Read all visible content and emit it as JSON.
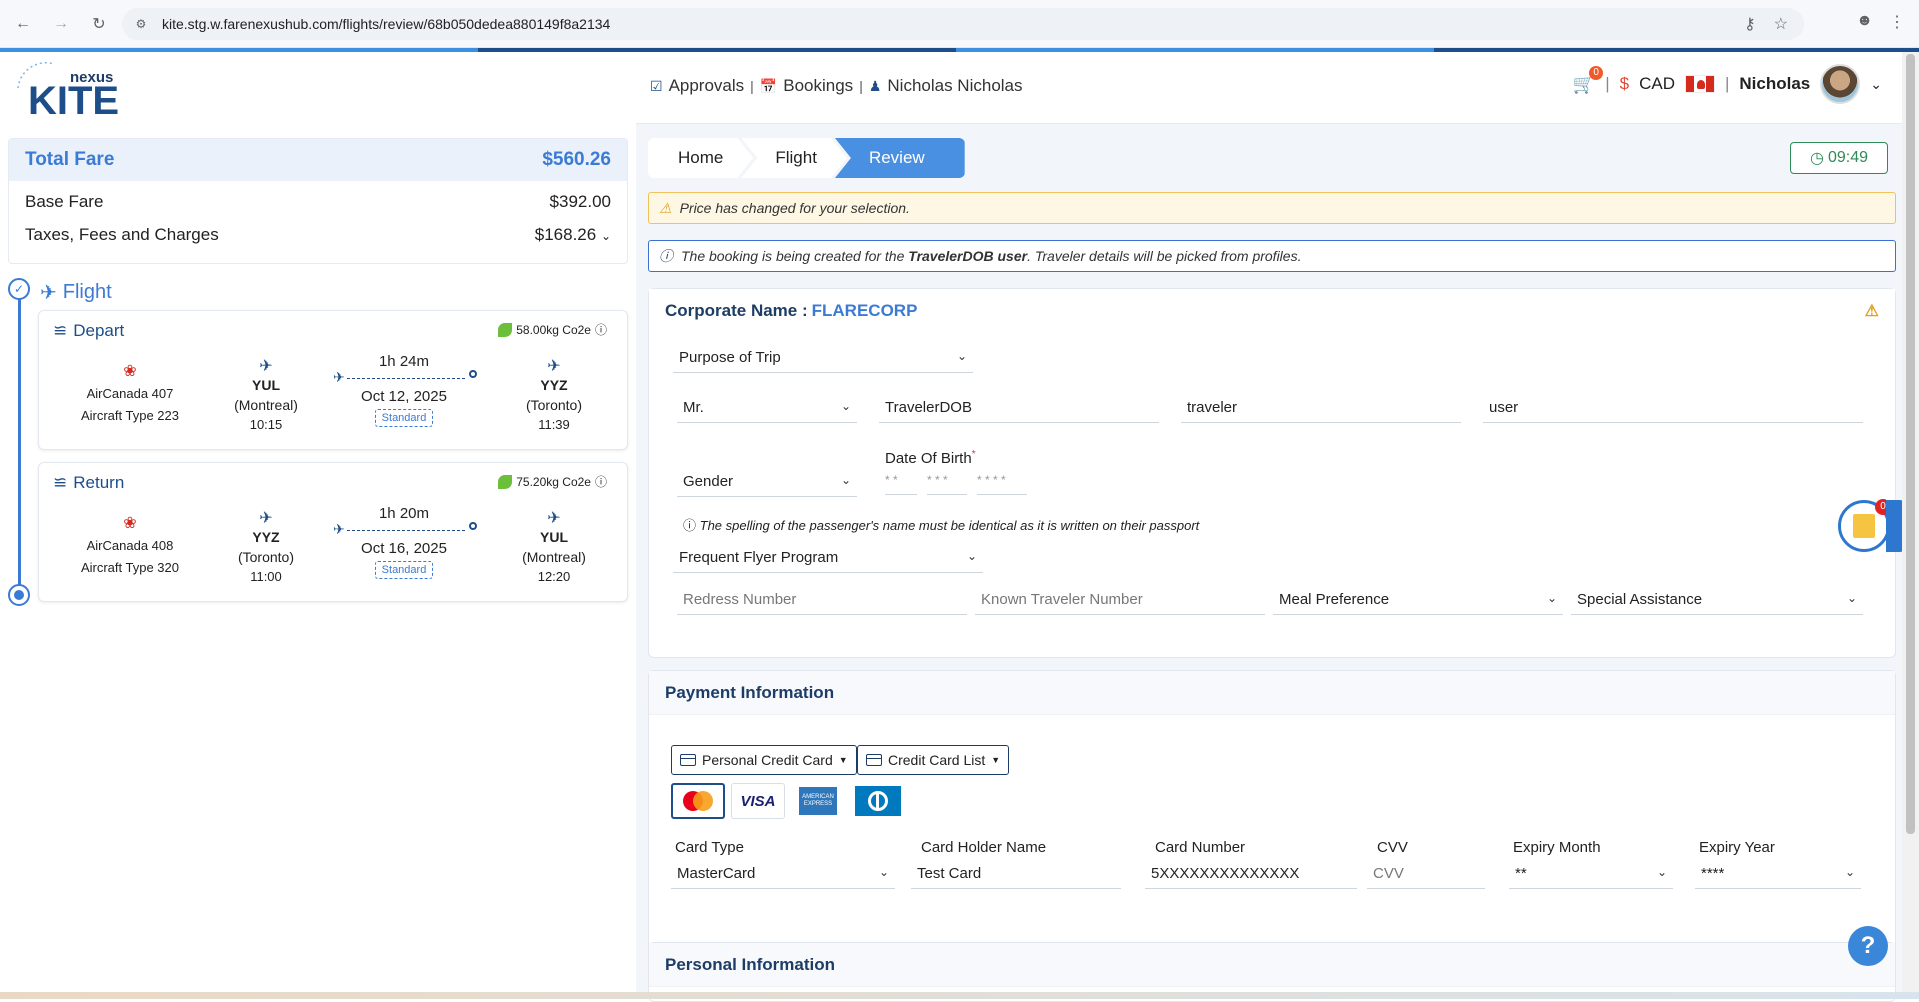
{
  "browser": {
    "url": "kite.stg.w.farenexushub.com/flights/review/68b050dedea880149f8a2134"
  },
  "logo": {
    "sub": "nexus",
    "main": "KITE"
  },
  "fare": {
    "total_label": "Total Fare",
    "total_value": "$560.26",
    "base_label": "Base Fare",
    "base_value": "$392.00",
    "taxes_label": "Taxes, Fees and Charges",
    "taxes_value": "$168.26"
  },
  "flight_section": {
    "title": "Flight"
  },
  "depart": {
    "label": "Depart",
    "co2": "58.00kg Co2e",
    "airline": "AirCanada 407",
    "aircraft": "Aircraft Type 223",
    "from_code": "YUL",
    "from_city": "(Montreal)",
    "from_time": "10:15",
    "duration": "1h 24m",
    "date": "Oct 12, 2025",
    "fare_class": "Standard",
    "to_code": "YYZ",
    "to_city": "(Toronto)",
    "to_time": "11:39"
  },
  "return": {
    "label": "Return",
    "co2": "75.20kg Co2e",
    "airline": "AirCanada 408",
    "aircraft": "Aircraft Type 320",
    "from_code": "YYZ",
    "from_city": "(Toronto)",
    "from_time": "11:00",
    "duration": "1h 20m",
    "date": "Oct 16, 2025",
    "fare_class": "Standard",
    "to_code": "YUL",
    "to_city": "(Montreal)",
    "to_time": "12:20"
  },
  "topnav": {
    "approvals": "Approvals",
    "bookings": "Bookings",
    "user_full": "Nicholas Nicholas",
    "cart_count": "0",
    "currency_symbol": "$",
    "currency": "CAD",
    "user_short": "Nicholas"
  },
  "breadcrumbs": [
    "Home",
    "Flight",
    "Review"
  ],
  "timer": "09:49",
  "alerts": {
    "warning": "Price has changed for your selection.",
    "info_prefix": "The booking is being created for the ",
    "info_user": "TravelerDOB user",
    "info_suffix": ". Traveler details will be picked from profiles."
  },
  "traveler": {
    "corporate_label": "Corporate Name :",
    "corporate_value": "FLARECORP",
    "purpose_placeholder": "Purpose of Trip",
    "title": "Mr.",
    "first_name": "TravelerDOB",
    "middle_name": "traveler",
    "last_name": "user",
    "gender_placeholder": "Gender",
    "dob_label": "Date Of Birth",
    "dob_required": "*",
    "dob_day": "* *",
    "dob_month": "* * *",
    "dob_year": "* * * *",
    "passport_note": "The spelling of the passenger's name must be identical as it is written on their passport",
    "ffp_placeholder": "Frequent Flyer Program",
    "redress_placeholder": "Redress Number",
    "ktn_placeholder": "Known Traveler Number",
    "meal_placeholder": "Meal Preference",
    "assist_placeholder": "Special Assistance"
  },
  "payment": {
    "title": "Payment Information",
    "personal_cc": "Personal Credit Card",
    "cc_list": "Credit Card List",
    "amex_text": "AMERICAN EXPRESS",
    "visa_text": "VISA",
    "card_type_label": "Card Type",
    "card_type_value": "MasterCard",
    "holder_label": "Card Holder Name",
    "holder_value": "Test Card",
    "number_label": "Card Number",
    "number_value": "5XXXXXXXXXXXXXX",
    "cvv_label": "CVV",
    "cvv_placeholder": "CVV",
    "exp_month_label": "Expiry Month",
    "exp_month_value": "**",
    "exp_year_label": "Expiry Year",
    "exp_year_value": "****"
  },
  "personal": {
    "title": "Personal Information"
  },
  "widget": {
    "count": "0"
  },
  "help": "?",
  "colors": {
    "accent": "#3b7bd4",
    "navy": "#1d3d66",
    "warn": "#f0c35a",
    "timer": "#2e8b57"
  }
}
